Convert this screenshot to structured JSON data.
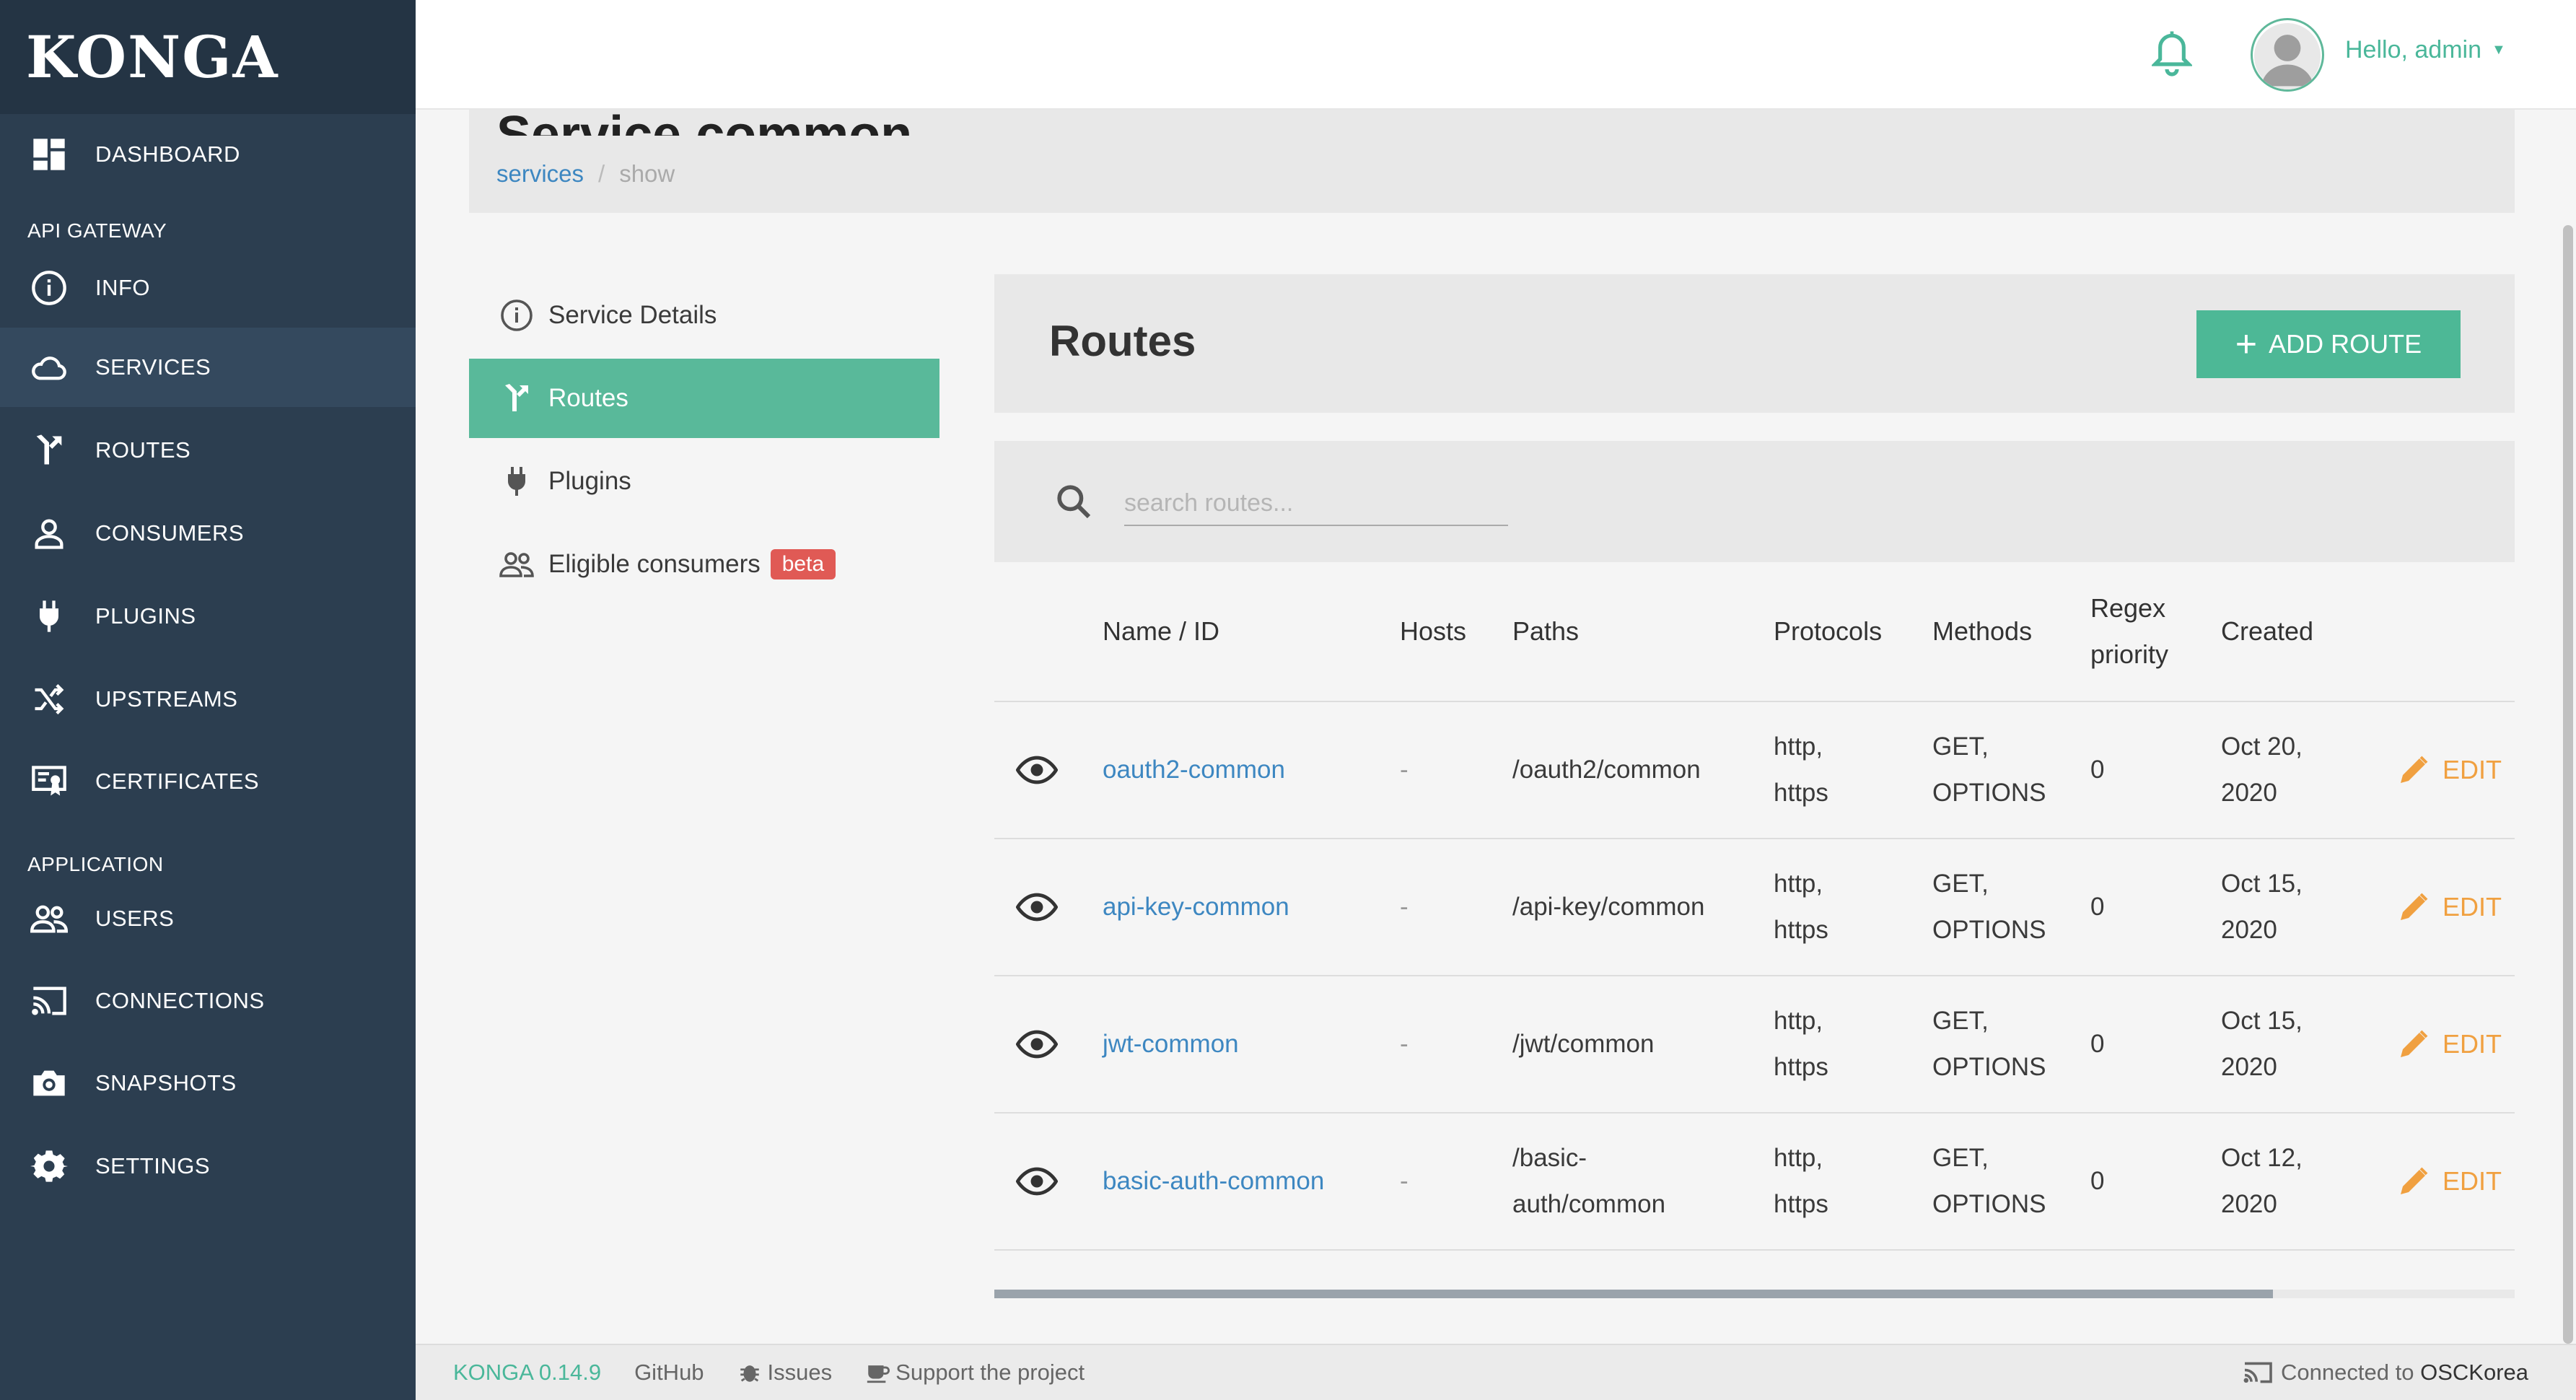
{
  "app": {
    "logo": "KONGA"
  },
  "sidebar": {
    "items": [
      {
        "label": "DASHBOARD",
        "icon": "dashboard-icon"
      },
      {
        "section": "API GATEWAY"
      },
      {
        "label": "INFO",
        "icon": "info-icon"
      },
      {
        "label": "SERVICES",
        "icon": "cloud-icon",
        "active": true
      },
      {
        "label": "ROUTES",
        "icon": "routes-icon"
      },
      {
        "label": "CONSUMERS",
        "icon": "user-icon"
      },
      {
        "label": "PLUGINS",
        "icon": "plug-icon"
      },
      {
        "label": "UPSTREAMS",
        "icon": "shuffle-icon"
      },
      {
        "label": "CERTIFICATES",
        "icon": "certificate-icon"
      },
      {
        "section": "APPLICATION"
      },
      {
        "label": "USERS",
        "icon": "users-icon"
      },
      {
        "label": "CONNECTIONS",
        "icon": "connections-icon"
      },
      {
        "label": "SNAPSHOTS",
        "icon": "camera-icon"
      },
      {
        "label": "SETTINGS",
        "icon": "gear-icon"
      }
    ]
  },
  "header": {
    "greeting": "Hello, admin"
  },
  "page": {
    "title": "Service common",
    "breadcrumb": {
      "link": "services",
      "separator": "/",
      "current": "show"
    }
  },
  "subnav": {
    "service_details": "Service Details",
    "routes": "Routes",
    "plugins": "Plugins",
    "eligible_consumers": "Eligible consumers",
    "beta": "beta"
  },
  "routes": {
    "title": "Routes",
    "add_button": "ADD ROUTE",
    "search_placeholder": "search routes...",
    "columns": [
      "Name / ID",
      "Hosts",
      "Paths",
      "Protocols",
      "Methods",
      "Regex priority",
      "Created"
    ],
    "edit_label": "EDIT",
    "rows": [
      {
        "name": "oauth2-common",
        "hosts": "-",
        "paths": "/oauth2/common",
        "protocols": "http, https",
        "methods": "GET, OPTIONS",
        "regex_priority": "0",
        "created": "Oct 20, 2020"
      },
      {
        "name": "api-key-common",
        "hosts": "-",
        "paths": "/api-key/common",
        "protocols": "http, https",
        "methods": "GET, OPTIONS",
        "regex_priority": "0",
        "created": "Oct 15, 2020"
      },
      {
        "name": "jwt-common",
        "hosts": "-",
        "paths": "/jwt/common",
        "protocols": "http, https",
        "methods": "GET, OPTIONS",
        "regex_priority": "0",
        "created": "Oct 15, 2020"
      },
      {
        "name": "basic-auth-common",
        "hosts": "-",
        "paths": "/basic-auth/common",
        "protocols": "http, https",
        "methods": "GET, OPTIONS",
        "regex_priority": "0",
        "created": "Oct 12, 2020"
      }
    ]
  },
  "footer": {
    "version": "KONGA 0.14.9",
    "github": "GitHub",
    "issues": "Issues",
    "support": "Support the project",
    "connected_prefix": "Connected to",
    "connection_name": "OSCKorea"
  },
  "colors": {
    "sidebar": "#2c3e50",
    "accent": "#59b99a",
    "link": "#3d87c1",
    "edit": "#f0a040",
    "beta": "#e05a55"
  }
}
